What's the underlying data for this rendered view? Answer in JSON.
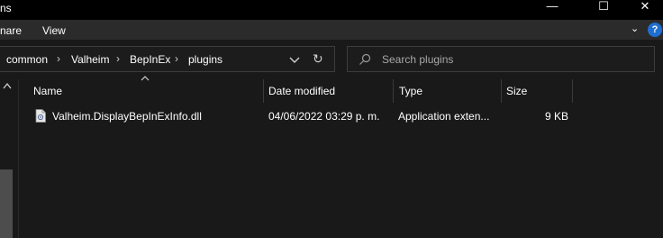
{
  "window": {
    "title_fragment": "ns",
    "minimize_glyph": "—",
    "maximize_glyph": "☐",
    "close_glyph": "✕"
  },
  "ribbon": {
    "menu": [
      "nare",
      "View"
    ],
    "help_label": "?",
    "collapse_glyph": "⌄"
  },
  "address": {
    "breadcrumbs": [
      "common",
      "Valheim",
      "BepInEx",
      "plugins"
    ],
    "separator": "›",
    "refresh_glyph": "↻"
  },
  "search": {
    "placeholder": "Search plugins",
    "value": ""
  },
  "columns": [
    "Name",
    "Date modified",
    "Type",
    "Size"
  ],
  "files": [
    {
      "name": "Valheim.DisplayBepInExInfo.dll",
      "date_modified": "04/06/2022 03:29 p. m.",
      "type": "Application exten...",
      "size": "9 KB",
      "icon": "dll-file-icon"
    }
  ],
  "colors": {
    "background": "#191919",
    "titlebar": "#000000",
    "ribbon": "#2b2b2b",
    "help_accent": "#1f6fd1"
  }
}
